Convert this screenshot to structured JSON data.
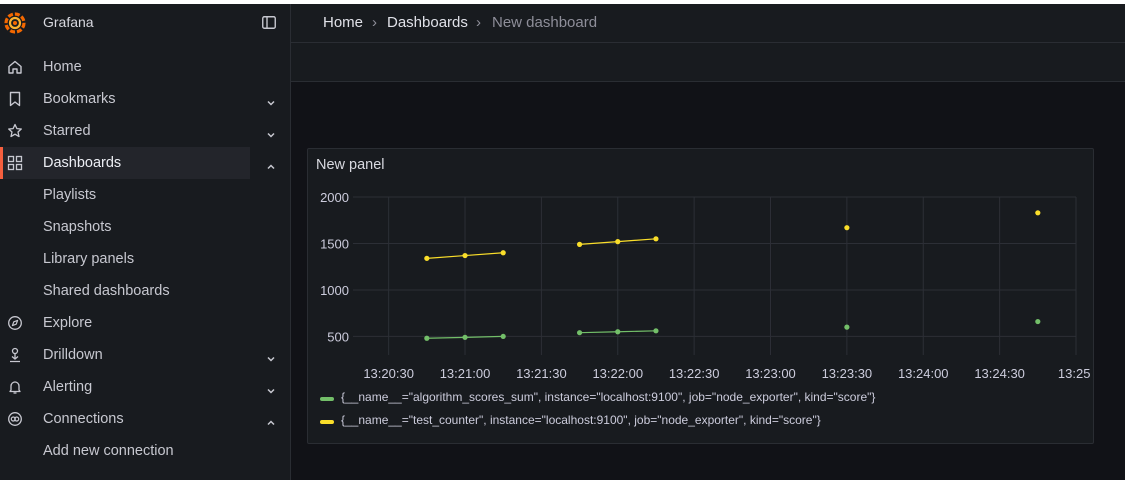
{
  "app": {
    "name": "Grafana"
  },
  "sidebar": {
    "items": [
      {
        "label": "Home"
      },
      {
        "label": "Bookmarks"
      },
      {
        "label": "Starred"
      },
      {
        "label": "Dashboards"
      },
      {
        "label": "Explore"
      },
      {
        "label": "Drilldown"
      },
      {
        "label": "Alerting"
      },
      {
        "label": "Connections"
      }
    ],
    "dashboards_children": [
      "Playlists",
      "Snapshots",
      "Library panels",
      "Shared dashboards"
    ],
    "connections_children": [
      "Add new connection"
    ]
  },
  "breadcrumb": {
    "items": [
      "Home",
      "Dashboards",
      "New dashboard"
    ],
    "separator": "›"
  },
  "panel": {
    "title": "New panel"
  },
  "colors": {
    "green": "#73bf69",
    "yellow": "#fade2a",
    "accent": "#f55f3e"
  },
  "chart_data": {
    "type": "line",
    "title": "New panel",
    "x_tick_labels": [
      "13:20:30",
      "13:21:00",
      "13:21:30",
      "13:22:00",
      "13:22:30",
      "13:23:00",
      "13:23:30",
      "13:24:00",
      "13:24:30",
      "13:25:"
    ],
    "y_tick_labels": [
      "2000",
      "1500",
      "1000",
      "500"
    ],
    "ylim": [
      300,
      2000
    ],
    "xlim": [
      "13:20:16",
      "13:25:00"
    ],
    "grid": true,
    "legend_position": "bottom",
    "series": [
      {
        "name": "{__name__=\"algorithm_scores_sum\", instance=\"localhost:9100\", job=\"node_exporter\", kind=\"score\"}",
        "color": "#73bf69",
        "segments": [
          [
            [
              "13:20:45",
              480
            ],
            [
              "13:21:00",
              490
            ],
            [
              "13:21:15",
              500
            ]
          ],
          [
            [
              "13:21:45",
              540
            ],
            [
              "13:22:00",
              550
            ],
            [
              "13:22:15",
              560
            ]
          ],
          [
            [
              "13:23:30",
              600
            ]
          ],
          [
            [
              "13:24:45",
              660
            ]
          ]
        ]
      },
      {
        "name": "{__name__=\"test_counter\", instance=\"localhost:9100\", job=\"node_exporter\", kind=\"score\"}",
        "color": "#fade2a",
        "segments": [
          [
            [
              "13:20:45",
              1340
            ],
            [
              "13:21:00",
              1370
            ],
            [
              "13:21:15",
              1400
            ]
          ],
          [
            [
              "13:21:45",
              1490
            ],
            [
              "13:22:00",
              1520
            ],
            [
              "13:22:15",
              1550
            ]
          ],
          [
            [
              "13:23:30",
              1670
            ]
          ],
          [
            [
              "13:24:45",
              1830
            ]
          ]
        ]
      }
    ]
  }
}
